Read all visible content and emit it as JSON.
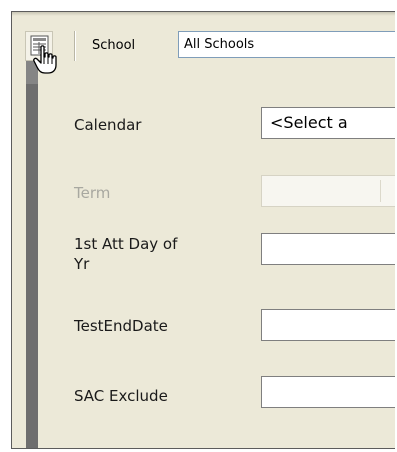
{
  "toolbar": {
    "grid_icon": "grid-icon",
    "cursor_icon": "hand-cursor-icon",
    "school_label": "School",
    "school_value": "All Schools"
  },
  "form": {
    "rows": [
      {
        "label": "Calendar",
        "value": "<Select a",
        "enabled": true
      },
      {
        "label": "Term",
        "value": "",
        "enabled": false
      },
      {
        "label": "1st Att Day of Yr",
        "value": "",
        "enabled": true
      },
      {
        "label": "TestEndDate",
        "value": "",
        "enabled": true
      },
      {
        "label": "SAC Exclude",
        "value": "",
        "enabled": true
      }
    ]
  },
  "colors": {
    "panel_bg": "#ece9d8",
    "sidebar_bar": "#6e6e6e",
    "disabled_text": "#a8a8a0",
    "input_border": "#7f7f7f"
  }
}
